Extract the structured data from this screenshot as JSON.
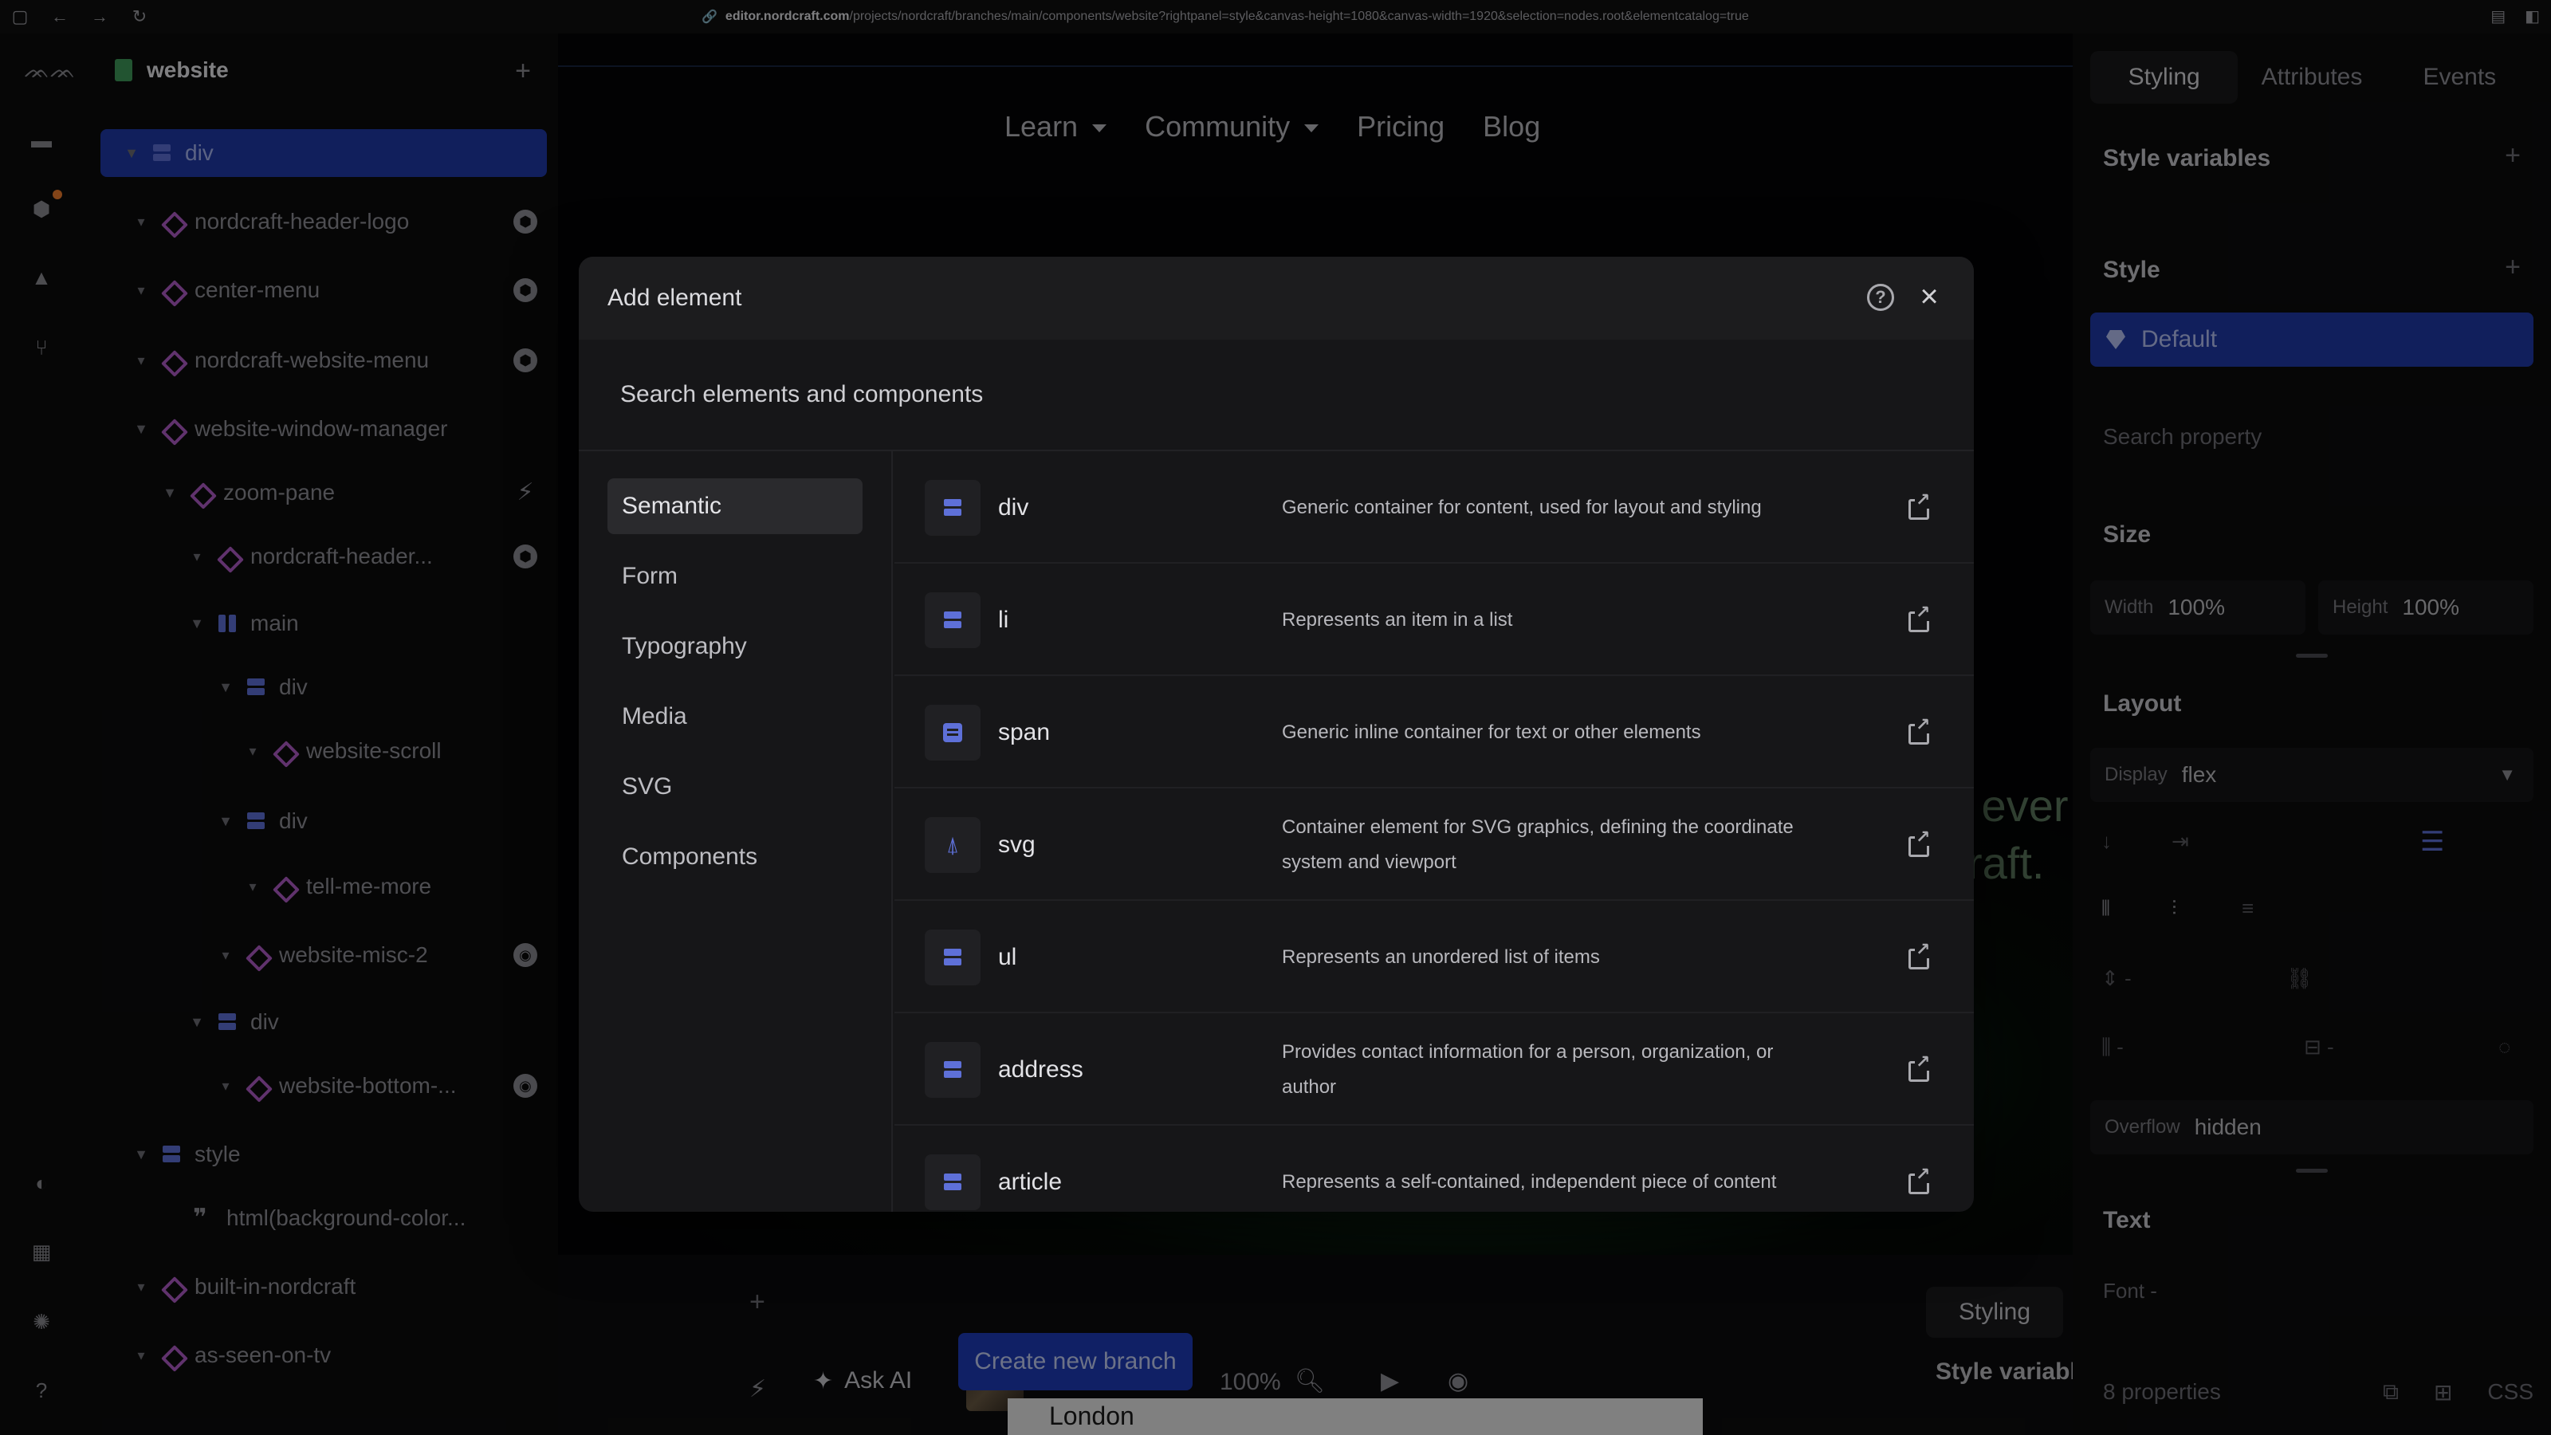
{
  "browser": {
    "url_host": "editor.nordcraft.com",
    "url_path": "/projects/nordcraft/branches/main/components/website?rightpanel=style&canvas-height=1080&canvas-width=1920&selection=nodes.root&elementcatalog=true"
  },
  "tree": {
    "title": "website",
    "nodes": [
      {
        "label": "div"
      },
      {
        "label": "nordcraft-header-logo"
      },
      {
        "label": "center-menu"
      },
      {
        "label": "nordcraft-website-menu"
      },
      {
        "label": "website-window-manager"
      },
      {
        "label": "zoom-pane"
      },
      {
        "label": "nordcraft-header..."
      },
      {
        "label": "main"
      },
      {
        "label": "div"
      },
      {
        "label": "website-scroll"
      },
      {
        "label": "div"
      },
      {
        "label": "tell-me-more"
      },
      {
        "label": "website-misc-2"
      },
      {
        "label": "div"
      },
      {
        "label": "website-bottom-..."
      },
      {
        "label": "style"
      },
      {
        "label": "html(background-color..."
      },
      {
        "label": "built-in-nordcraft"
      },
      {
        "label": "as-seen-on-tv"
      }
    ]
  },
  "canvas": {
    "nav": [
      "Learn",
      "Community",
      "Pricing",
      "Blog"
    ],
    "bg_text": [
      "craft.",
      "s ever"
    ],
    "toolbar": {
      "styling": "Styling",
      "ask_ai": "Ask AI",
      "zoom": "100%",
      "create_branch": "Create new branch",
      "london": "London"
    }
  },
  "right_panel": {
    "tabs": [
      "Styling",
      "Attributes",
      "Events"
    ],
    "style_variables": "Style variables",
    "style": "Style",
    "default": "Default",
    "search_property": "Search property",
    "size": "Size",
    "width_label": "Width",
    "width_value": "100%",
    "height_label": "Height",
    "height_value": "100%",
    "layout": "Layout",
    "display_label": "Display",
    "display_value": "flex",
    "overflow_label": "Overflow",
    "overflow_value": "hidden",
    "text": "Text",
    "font_label": "Font",
    "font_value": "-",
    "properties": "8 properties",
    "css": "CSS",
    "style_variables_cut": "Style variabl"
  },
  "modal": {
    "title": "Add element",
    "search_placeholder": "Search elements and components",
    "categories": [
      "Semantic",
      "Form",
      "Typography",
      "Media",
      "SVG",
      "Components"
    ],
    "elements": [
      {
        "name": "div",
        "desc": "Generic container for content, used for layout and styling",
        "icon": "div-icon"
      },
      {
        "name": "li",
        "desc": "Represents an item in a list",
        "icon": "div-icon"
      },
      {
        "name": "span",
        "desc": "Generic inline container for text or other elements",
        "icon": "span-icon"
      },
      {
        "name": "svg",
        "desc": "Container element for SVG graphics, defining the coordinate system and viewport",
        "icon": "svg-icon"
      },
      {
        "name": "ul",
        "desc": "Represents an unordered list of items",
        "icon": "div-icon"
      },
      {
        "name": "address",
        "desc": "Provides contact information for a person, organization, or author",
        "icon": "div-icon"
      },
      {
        "name": "article",
        "desc": "Represents a self-contained, independent piece of content",
        "icon": "div-icon"
      }
    ]
  },
  "colors": {
    "accent": "#1f3aa8",
    "element_icon": "#5e70d8",
    "component_icon": "#b05cc6",
    "notification": "#ef7d2d"
  }
}
